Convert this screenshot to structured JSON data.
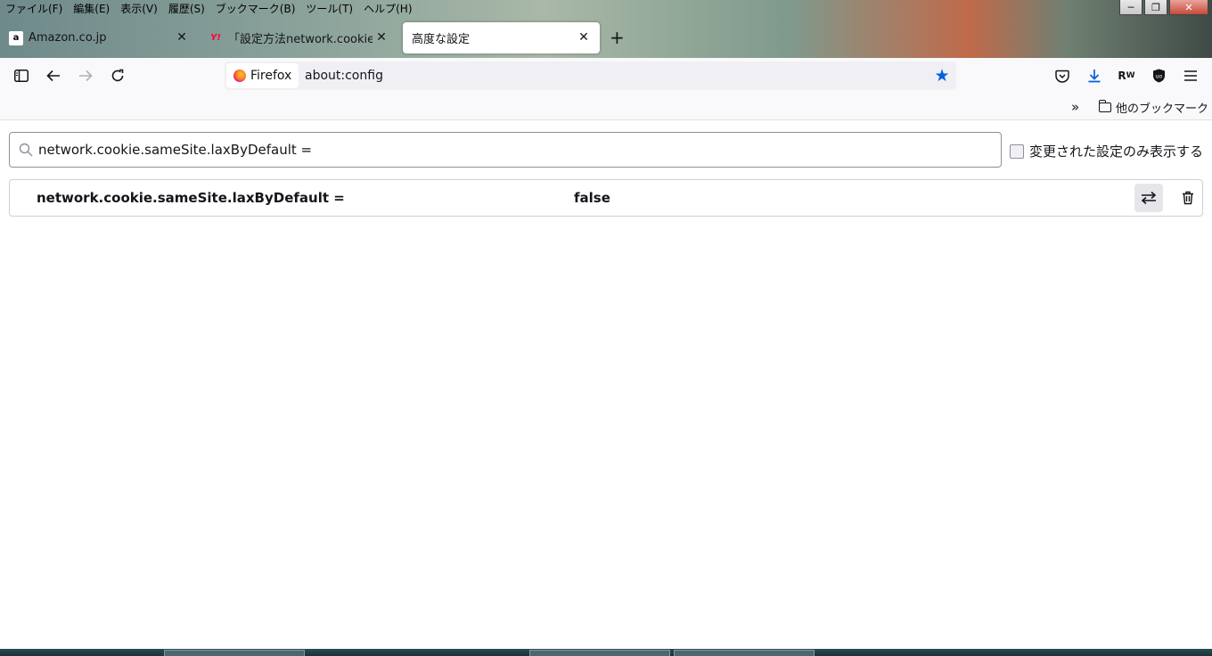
{
  "menubar": {
    "items": [
      "ファイル(F)",
      "編集(E)",
      "表示(V)",
      "履歴(S)",
      "ブックマーク(B)",
      "ツール(T)",
      "ヘルプ(H)"
    ]
  },
  "tabs": [
    {
      "title": "Amazon.co.jp",
      "favicon": "amazon-icon",
      "active": false
    },
    {
      "title": "「設定方法network.cookie.sa",
      "favicon": "yahoo-icon",
      "active": false
    },
    {
      "title": "高度な設定",
      "favicon": "",
      "active": true
    }
  ],
  "navbar": {
    "identity_label": "Firefox",
    "url": "about:config"
  },
  "bookmarks_bar": {
    "other_bookmarks_label": "他のブックマーク"
  },
  "config": {
    "search_value": "network.cookie.sameSite.laxByDefault =",
    "only_modified_label": "変更された設定のみ表示する",
    "only_modified_checked": false,
    "pref": {
      "name": "network.cookie.sameSite.laxByDefault =",
      "value": "false"
    }
  },
  "colors": {
    "accent": "#0061e0",
    "text": "#15141a"
  }
}
